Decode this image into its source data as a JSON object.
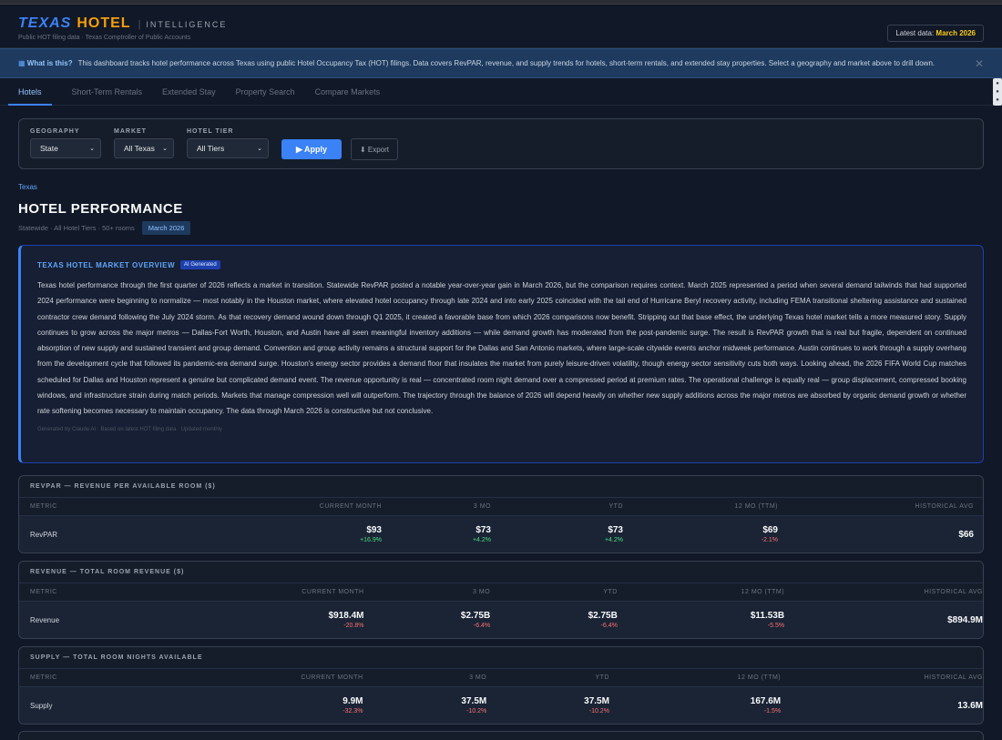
{
  "header": {
    "brand_texas": "TEXAS",
    "brand_hotel": "HOTEL",
    "brand_intel": "INTELLIGENCE",
    "subtitle": "Public HOT filing data · Texas Comptroller of Public Accounts",
    "latest_label": "Latest data:",
    "latest_value": "March 2026"
  },
  "banner": {
    "icon": "info-icon",
    "title": "What is this?",
    "text": "This dashboard tracks hotel performance across Texas using public Hotel Occupancy Tax (HOT) filings. Data covers RevPAR, revenue, and supply trends for hotels, short-term rentals, and extended stay properties. Select a geography and market above to drill down.",
    "close": "✕"
  },
  "tabs": [
    "Hotels",
    "Short-Term Rentals",
    "Extended Stay",
    "Property Search",
    "Compare Markets"
  ],
  "filters": {
    "geography_label": "GEOGRAPHY",
    "geography_value": "State",
    "market_label": "MARKET",
    "market_value": "All Texas",
    "tier_label": "HOTEL TIER",
    "tier_value": "All Tiers",
    "apply_label": "▶ Apply",
    "export_label": "⬇ Export"
  },
  "page": {
    "breadcrumb": "Texas",
    "title": "HOTEL PERFORMANCE",
    "subtitle": "Statewide · All Hotel Tiers · 50+ rooms",
    "period": "March 2026"
  },
  "overview": {
    "title": "TEXAS HOTEL MARKET OVERVIEW",
    "badge": "AI Generated",
    "text": "Texas hotel performance through the first quarter of 2026 reflects a market in transition. Statewide RevPAR posted a notable year-over-year gain in March 2026, but the comparison requires context. March 2025 represented a period when several demand tailwinds that had supported 2024 performance were beginning to normalize — most notably in the Houston market, where elevated hotel occupancy through late 2024 and into early 2025 coincided with the tail end of Hurricane Beryl recovery activity, including FEMA transitional sheltering assistance and sustained contractor crew demand following the July 2024 storm. As that recovery demand wound down through Q1 2025, it created a favorable base from which 2026 comparisons now benefit. Stripping out that base effect, the underlying Texas hotel market tells a more measured story. Supply continues to grow across the major metros — Dallas-Fort Worth, Houston, and Austin have all seen meaningful inventory additions — while demand growth has moderated from the post-pandemic surge. The result is RevPAR growth that is real but fragile, dependent on continued absorption of new supply and sustained transient and group demand. Convention and group activity remains a structural support for the Dallas and San Antonio markets, where large-scale citywide events anchor midweek performance. Austin continues to work through a supply overhang from the development cycle that followed its pandemic-era demand surge. Houston's energy sector provides a demand floor that insulates the market from purely leisure-driven volatility, though energy sector sensitivity cuts both ways. Looking ahead, the 2026 FIFA World Cup matches scheduled for Dallas and Houston represent a genuine but complicated demand event. The revenue opportunity is real — concentrated room night demand over a compressed period at premium rates. The operational challenge is equally real — group displacement, compressed booking windows, and infrastructure strain during match periods. Markets that manage compression well will outperform. The trajectory through the balance of 2026 will depend heavily on whether new supply additions across the major metros are absorbed by organic demand growth or whether rate softening becomes necessary to maintain occupancy. The data through March 2026 is constructive but not conclusive.",
    "footer": "Generated by Claude AI · Based on latest HOT filing data · Updated monthly"
  },
  "tables": [
    {
      "title": "REVPAR — REVENUE PER AVAILABLE ROOM ($)",
      "headers": [
        "METRIC",
        "CURRENT MONTH",
        "3 MO",
        "YTD",
        "12 MO (TTM)",
        "HISTORICAL AVG"
      ],
      "row_label": "RevPAR",
      "values": [
        "$93",
        "$73",
        "$73",
        "$69",
        "$66"
      ],
      "changes": [
        "+16.9%",
        "+4.2%",
        "+4.2%",
        "-2.1%",
        ""
      ],
      "dirs": [
        "up",
        "up",
        "up",
        "down",
        ""
      ]
    },
    {
      "title": "REVENUE — TOTAL ROOM REVENUE ($)",
      "headers": [
        "METRIC",
        "CURRENT MONTH",
        "3 MO",
        "YTD",
        "12 MO (TTM)",
        "HISTORICAL AVG"
      ],
      "row_label": "Revenue",
      "values": [
        "$918.4M",
        "$2.75B",
        "$2.75B",
        "$11.53B",
        "$894.9M"
      ],
      "changes": [
        "-20.8%",
        "-6.4%",
        "-6.4%",
        "-5.5%",
        ""
      ],
      "dirs": [
        "down",
        "down",
        "down",
        "down",
        ""
      ]
    },
    {
      "title": "SUPPLY — TOTAL ROOM NIGHTS AVAILABLE",
      "headers": [
        "METRIC",
        "CURRENT MONTH",
        "3 MO",
        "YTD",
        "12 MO (TTM)",
        "HISTORICAL AVG"
      ],
      "row_label": "Supply",
      "values": [
        "9.9M",
        "37.5M",
        "37.5M",
        "167.6M",
        "13.6M"
      ],
      "changes": [
        "-32.3%",
        "-10.2%",
        "-10.2%",
        "-1.5%",
        ""
      ],
      "dirs": [
        "down",
        "down",
        "down",
        "down",
        ""
      ]
    }
  ]
}
